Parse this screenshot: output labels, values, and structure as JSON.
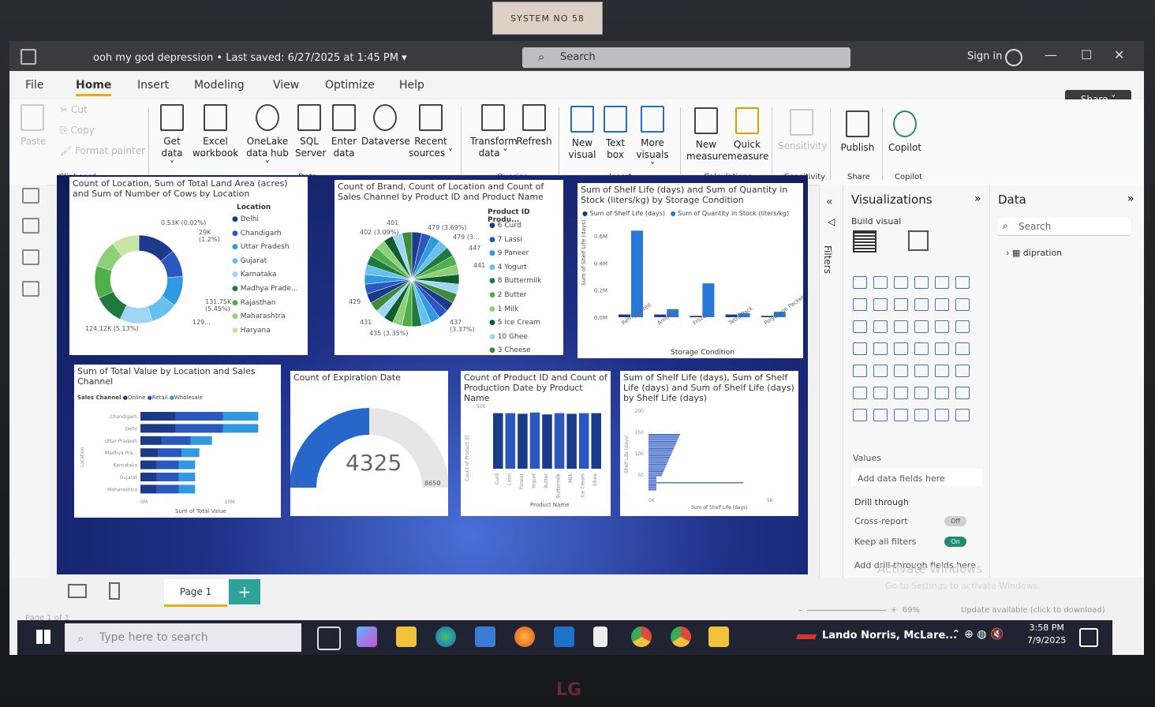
{
  "sticker_text": "SYSTEM NO 58",
  "monitor_brand": "LG",
  "titlebar": {
    "title": "ooh my god depression",
    "saved": "Last saved: 6/27/2025 at 1:45 PM",
    "search_placeholder": "Search",
    "sign_in": "Sign in",
    "share": "Share"
  },
  "tabs": [
    "File",
    "Home",
    "Insert",
    "Modeling",
    "View",
    "Optimize",
    "Help"
  ],
  "ribbon": {
    "clipboard": [
      "Paste",
      "Cut",
      "Copy",
      "Format painter"
    ],
    "buttons": [
      {
        "label1": "Get",
        "label2": "data ˅"
      },
      {
        "label1": "Excel",
        "label2": "workbook"
      },
      {
        "label1": "OneLake",
        "label2": "data hub ˅"
      },
      {
        "label1": "SQL",
        "label2": "Server"
      },
      {
        "label1": "Enter",
        "label2": "data"
      },
      {
        "label1": "Dataverse",
        "label2": ""
      },
      {
        "label1": "Recent",
        "label2": "sources ˅"
      },
      {
        "label1": "Transform",
        "label2": "data ˅"
      },
      {
        "label1": "Refresh",
        "label2": ""
      },
      {
        "label1": "New",
        "label2": "visual"
      },
      {
        "label1": "Text",
        "label2": "box"
      },
      {
        "label1": "More",
        "label2": "visuals ˅"
      },
      {
        "label1": "New",
        "label2": "measure"
      },
      {
        "label1": "Quick",
        "label2": "measure"
      },
      {
        "label1": "Sensitivity",
        "label2": ""
      },
      {
        "label1": "Publish",
        "label2": ""
      },
      {
        "label1": "Copilot",
        "label2": ""
      }
    ],
    "groups": [
      "Clipboard",
      "Data",
      "Queries",
      "Insert",
      "Calculations",
      "Sensitivity",
      "Share",
      "Copilot"
    ]
  },
  "visuals": {
    "v1": {
      "title": "Count of Location, Sum of Total Land Area (acres) and Sum of Number of Cows by Location",
      "legend_title": "Location",
      "legend": [
        "Delhi",
        "Chandigarh",
        "Uttar Pradesh",
        "Gujarat",
        "Karnataka",
        "Madhya Prade...",
        "Rajasthan",
        "Maharashtra",
        "Haryana"
      ],
      "labels": [
        "0.53K (0.02%)",
        "29K (1.2%)",
        "131.75K (5.45%)",
        "124.12K (5.13%)",
        "129..."
      ]
    },
    "v2": {
      "title": "Count of Brand, Count of Location and Count of Sales Channel by Product ID and Product Name",
      "legend_title": "Product ID Produ...",
      "legend": [
        "6 Curd",
        "7 Lassi",
        "9 Paneer",
        "4 Yogurt",
        "8 Buttermilk",
        "2 Butter",
        "1 Milk",
        "5 Ice Cream",
        "10 Ghee",
        "3 Cheese"
      ],
      "labels": [
        "401",
        "402 (3.09%)",
        "479 (3.69%)",
        "479 (3...",
        "447",
        "441",
        "429",
        "431",
        "435 (3.35%)",
        "437 (3.37%)"
      ]
    },
    "v3": {
      "title": "Sum of Shelf Life (days) and Sum of Quantity in Stock (liters/kg) by Storage Condition",
      "legend": [
        "Sum of Shelf Life (days)",
        "Sum of Quantity in Stock (liters/kg)"
      ],
      "ylabel": "Sum of Shelf Life (days)",
      "xlabel": "Storage Condition",
      "yticks": [
        "0.6M",
        "0.4M",
        "0.2M",
        "0.0M"
      ],
      "categories": [
        "Refrigerated",
        "Ambient",
        "Frozen",
        "Tetra Pack",
        "Polythene Packet"
      ]
    },
    "v4": {
      "title": "Sum of Total Value by Location and Sales Channel",
      "legend_title": "Sales Channel",
      "legend": [
        "Online",
        "Retail",
        "Wholesale"
      ],
      "categories": [
        "Chandigarh",
        "Delhi",
        "Uttar Pradesh",
        "Madhya Pra...",
        "Karnataka",
        "Gujarat",
        "Maharashtra"
      ],
      "xticks": [
        "0M",
        "10M"
      ],
      "ylabel": "Location",
      "xlabel": "Sum of Total Value"
    },
    "v5": {
      "title": "Count of Expiration Date",
      "value": "4325",
      "min": "0",
      "max": "8650"
    },
    "v6": {
      "title": "Count of Product ID and Count of Production Date by Product Name",
      "ylabel": "Count of Product ID",
      "xlabel": "Product Name",
      "ytick": "500",
      "categories": [
        "Curd",
        "Lassi",
        "Paneer",
        "Yogurt",
        "Butter",
        "Buttermilk",
        "Milk",
        "Ice Cream",
        "Ghee"
      ]
    },
    "v7": {
      "title": "Sum of Shelf Life (days), Sum of Shelf Life (days) and Sum of Shelf Life (days) by Shelf Life (days)",
      "ylabel": "Shelf Life (days)",
      "xlabel": "Sum of Shelf Life (days)",
      "yticks": [
        "200",
        "150",
        "100",
        "50"
      ],
      "xticks": [
        "0K",
        "5K"
      ]
    }
  },
  "chart_data": [
    {
      "type": "pie",
      "title": "Count of Location, Sum of Total Land Area (acres) and Sum of Number of Cows by Location",
      "categories": [
        "Delhi",
        "Chandigarh",
        "Uttar Pradesh",
        "Gujarat",
        "Karnataka",
        "Madhya Prade...",
        "Rajasthan",
        "Maharashtra",
        "Haryana"
      ]
    },
    {
      "type": "pie",
      "title": "Count of Brand, Count of Location and Count of Sales Channel by Product ID and Product Name",
      "categories": [
        "6 Curd",
        "7 Lassi",
        "9 Paneer",
        "4 Yogurt",
        "8 Buttermilk",
        "2 Butter",
        "1 Milk",
        "5 Ice Cream",
        "10 Ghee",
        "3 Cheese"
      ]
    },
    {
      "type": "bar",
      "title": "Sum of Shelf Life (days) and Sum of Quantity in Stock (liters/kg) by Storage Condition",
      "categories": [
        "Refrigerated",
        "Ambient",
        "Frozen",
        "Tetra Pack",
        "Polythene Packet"
      ],
      "series": [
        {
          "name": "Sum of Shelf Life (days)",
          "values": [
            0.02,
            0.02,
            0.01,
            0.02,
            0.01
          ]
        },
        {
          "name": "Sum of Quantity in Stock (liters/kg)",
          "values": [
            0.64,
            0.06,
            0.25,
            0.03,
            0.04
          ]
        }
      ],
      "ylim": [
        0,
        0.7
      ]
    },
    {
      "type": "bar",
      "title": "Sum of Total Value by Location and Sales Channel",
      "categories": [
        "Chandigarh",
        "Delhi",
        "Uttar Pradesh",
        "Madhya Pra...",
        "Karnataka",
        "Gujarat",
        "Maharashtra"
      ],
      "values": [
        14,
        14,
        8.5,
        7,
        6.5,
        6.5,
        6.5
      ],
      "xlim": [
        0,
        15
      ]
    },
    {
      "type": "bar",
      "title": "Count of Product ID and Count of Production Date by Product Name",
      "categories": [
        "Curd",
        "Lassi",
        "Paneer",
        "Yogurt",
        "Butter",
        "Buttermilk",
        "Milk",
        "Ice Cream",
        "Ghee"
      ],
      "values": [
        440,
        440,
        435,
        445,
        430,
        440,
        435,
        440,
        440
      ],
      "ylim": [
        0,
        500
      ]
    }
  ],
  "filters_label": "Filters",
  "viz_pane": {
    "title": "Visualizations",
    "build": "Build visual",
    "values": "Values",
    "add_fields": "Add data fields here",
    "drill": "Drill through",
    "cross_report": "Cross-report",
    "keep_filters": "Keep all filters",
    "add_drill": "Add drill-through fields here",
    "off": "Off",
    "on": "On",
    "r": "R",
    "py": "Py",
    "more": "..."
  },
  "data_pane": {
    "title": "Data",
    "search": "Search",
    "table": "dipration"
  },
  "page": {
    "tab": "Page 1",
    "status": "Page 1 of 1",
    "zoom": "69%",
    "update": "Update available (click to download)",
    "activate": "Activate Windows",
    "activate_sub": "Go to Settings to activate Windows."
  },
  "taskbar": {
    "search": "Type here to search",
    "news": "Lando Norris, McLare...",
    "time": "3:58 PM",
    "date": "7/9/2025"
  }
}
